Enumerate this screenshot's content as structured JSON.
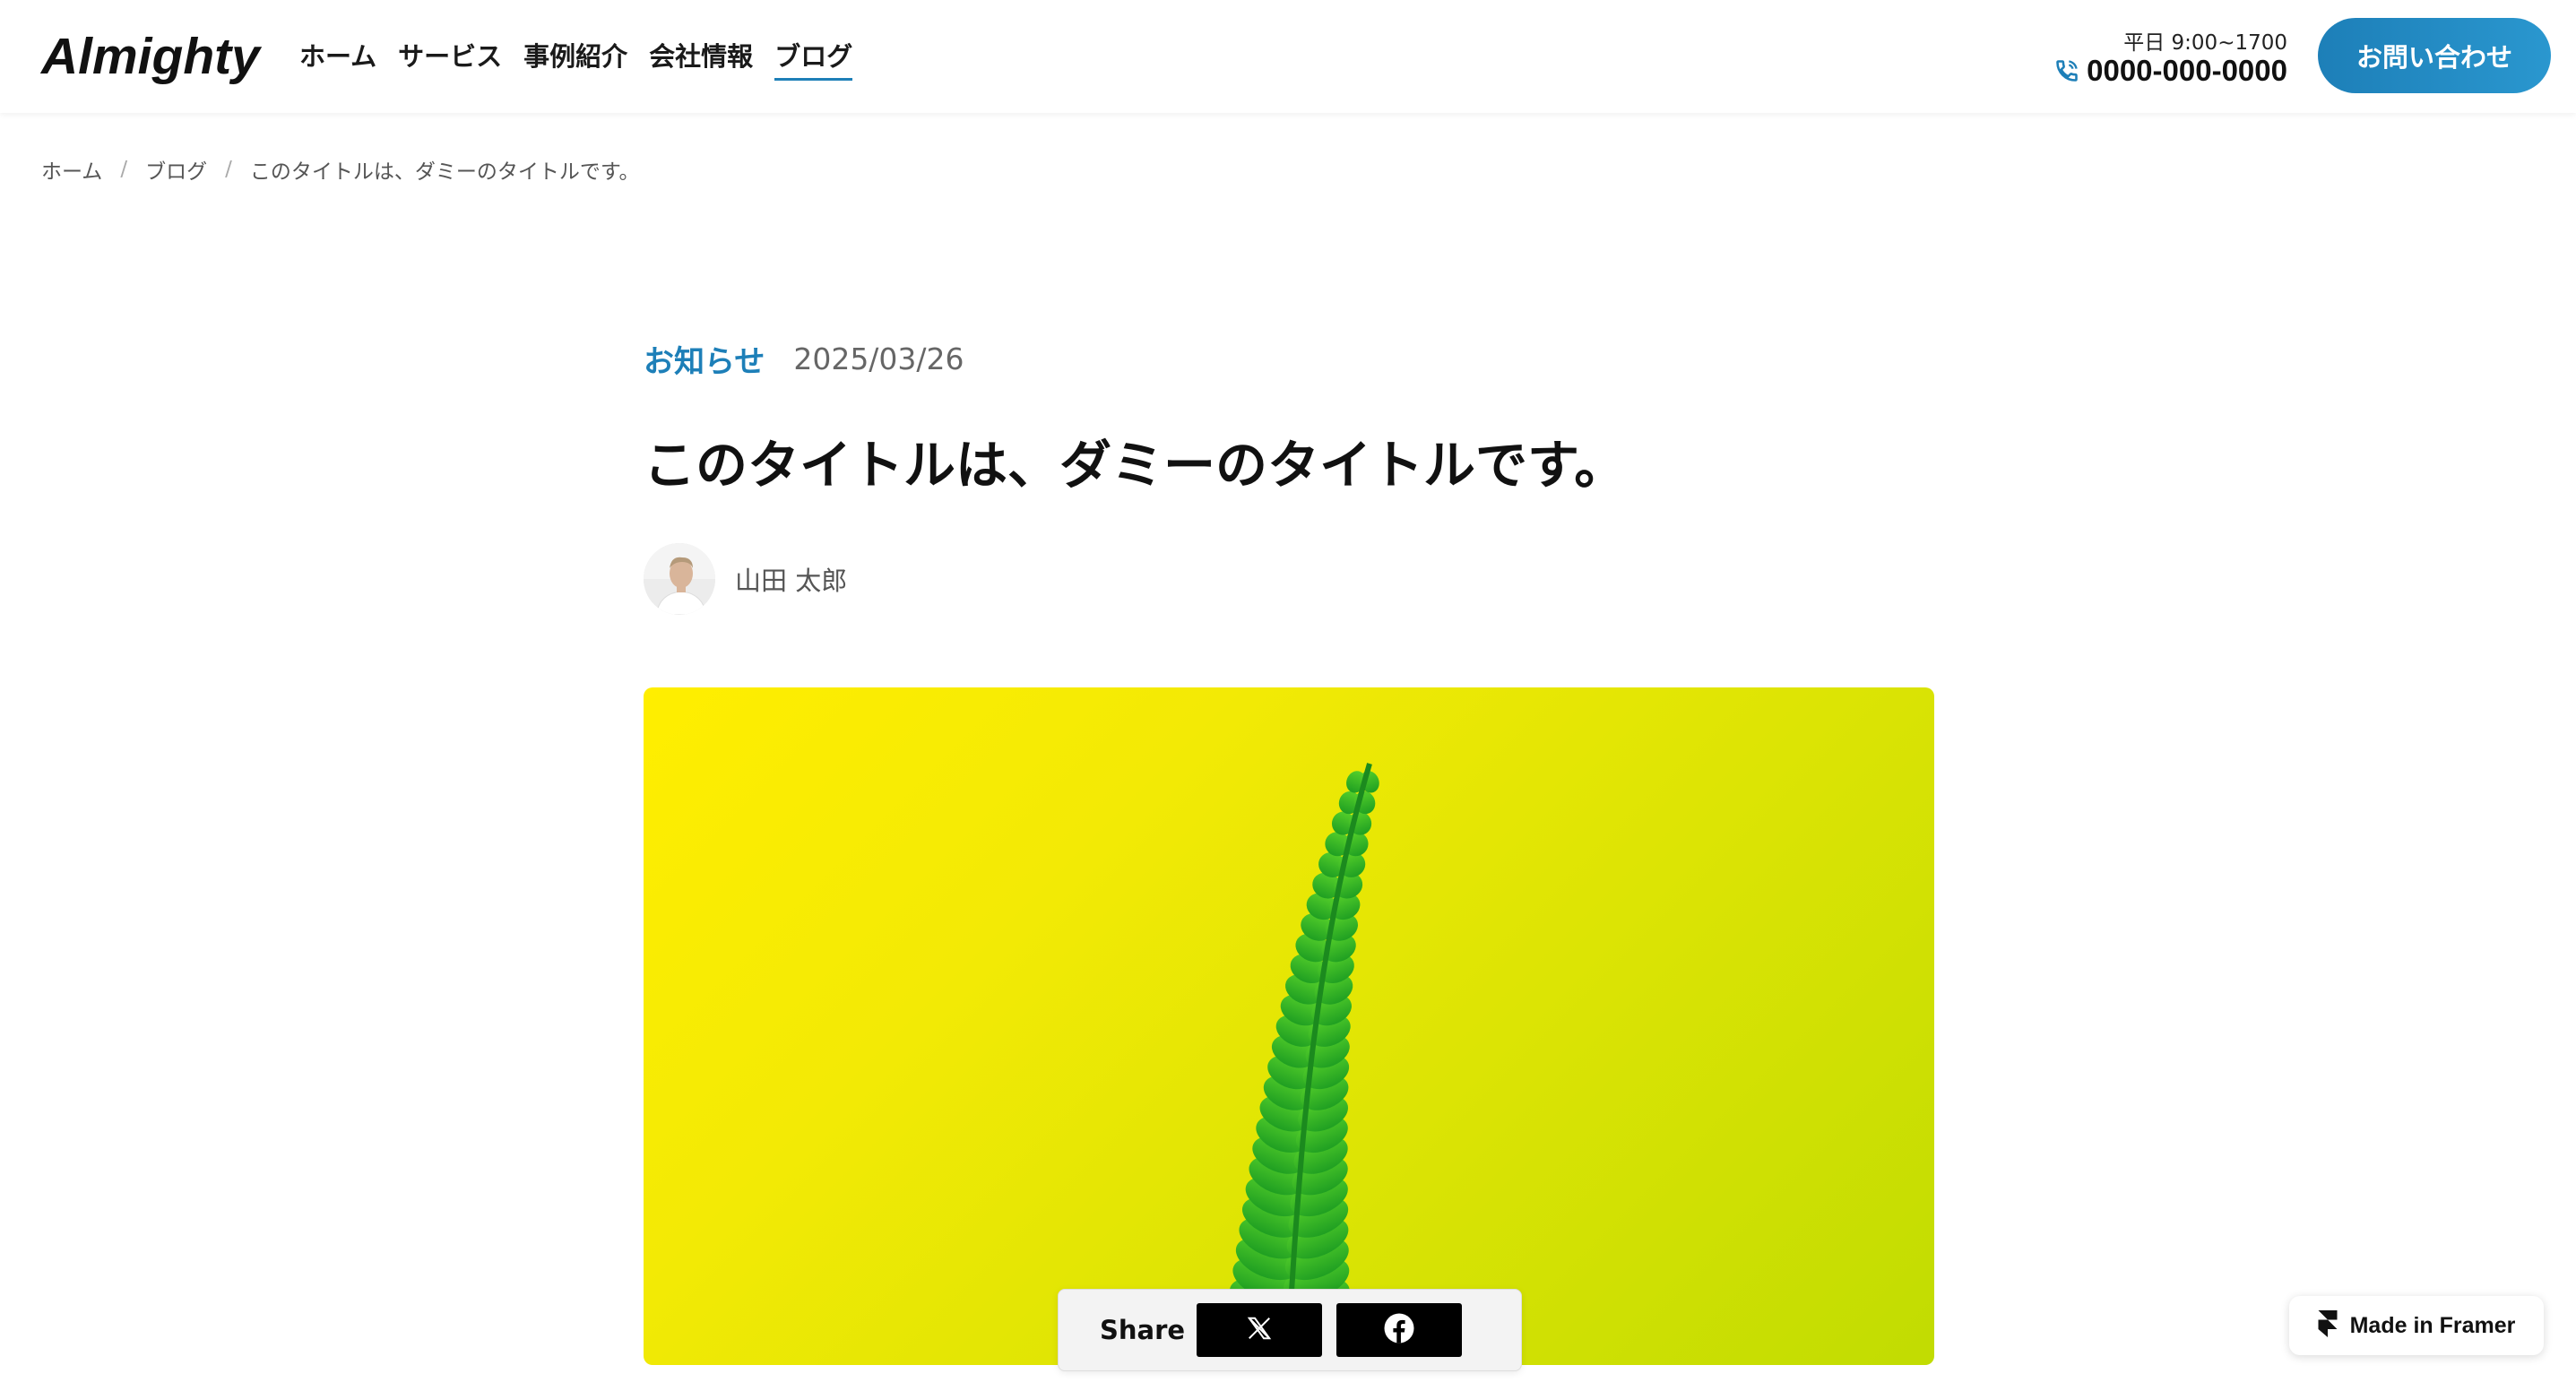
{
  "header": {
    "logo": "Almighty",
    "nav": [
      {
        "label": "ホーム"
      },
      {
        "label": "サービス"
      },
      {
        "label": "事例紹介"
      },
      {
        "label": "会社情報"
      },
      {
        "label": "ブログ",
        "active": true
      }
    ],
    "hours": "平日 9:00~1700",
    "phone": "0000-000-0000",
    "contact_button": "お問い合わせ"
  },
  "breadcrumb": [
    "ホーム",
    "ブログ",
    "このタイトルは、ダミーのタイトルです。"
  ],
  "article": {
    "category": "お知らせ",
    "date": "2025/03/26",
    "title": "このタイトルは、ダミーのタイトルです。",
    "author": "山田 太郎",
    "hero_image": "fern-leaf-on-yellow"
  },
  "share": {
    "label": "Share",
    "buttons": [
      {
        "icon": "x-icon"
      },
      {
        "icon": "facebook-icon"
      }
    ]
  },
  "badge": {
    "label": "Made in Framer"
  },
  "colors": {
    "accent": "#1d7fb8",
    "hero_bg": "#f0e800",
    "fern": "#2bb52a"
  }
}
